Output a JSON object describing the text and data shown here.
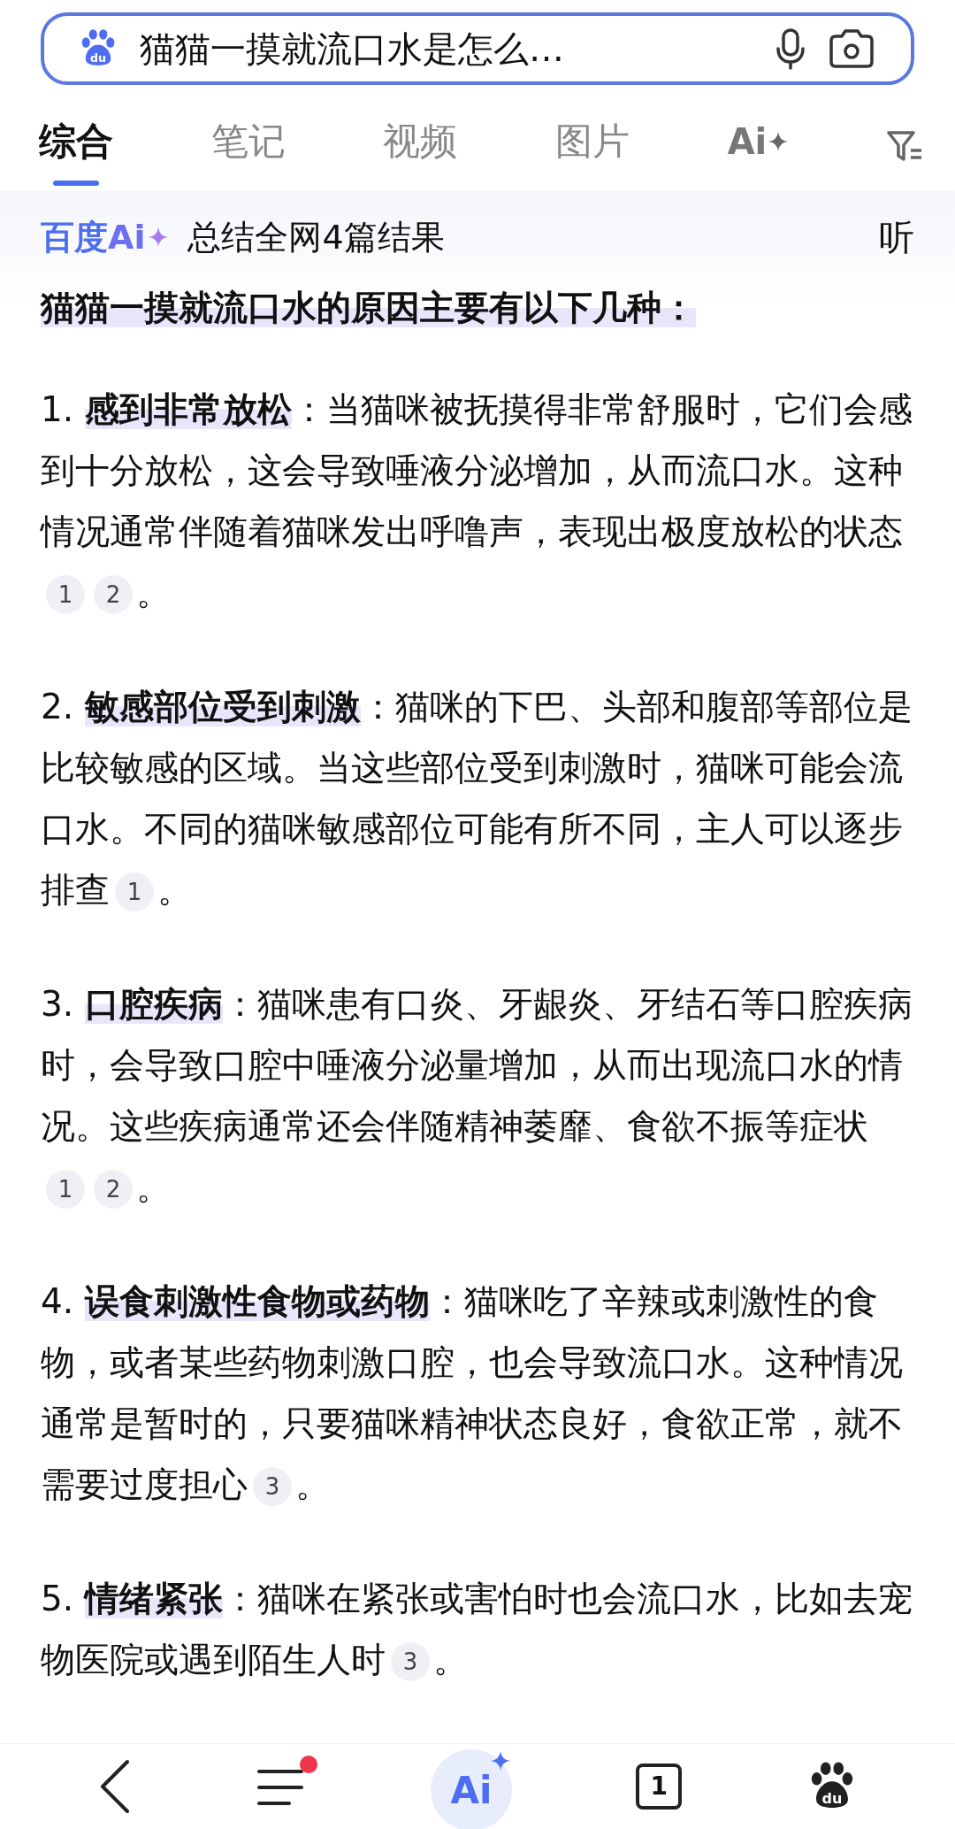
{
  "search": {
    "logo_text": "du",
    "query": "猫猫一摸就流口水是怎么…"
  },
  "tabs": [
    {
      "label": "综合",
      "kind": "text",
      "selected": true
    },
    {
      "label": "笔记",
      "kind": "text",
      "selected": false
    },
    {
      "label": "视频",
      "kind": "text",
      "selected": false
    },
    {
      "label": "图片",
      "kind": "text",
      "selected": false
    },
    {
      "label": "Ai",
      "kind": "ai",
      "selected": false
    }
  ],
  "ai_header": {
    "brand": "百度",
    "brand_ai": "Ai",
    "summary": "总结全网4篇结果",
    "listen": "听"
  },
  "intro": "猫猫一摸就流口水的原因主要有以下几种：",
  "items": [
    {
      "number": "1.",
      "title": "感到非常放松",
      "text": "：当猫咪被抚摸得非常舒服时，它们会感到十分放松，这会导致唾液分泌增加，从而流口水。这种情况通常伴随着猫咪发出呼噜声，表现出极度放松的状态",
      "citations": [
        "1",
        "2"
      ],
      "end": "。"
    },
    {
      "number": "2.",
      "title": "敏感部位受到刺激",
      "text": "：猫咪的下巴、头部和腹部等部位是比较敏感的区域。当这些部位受到刺激时，猫咪可能会流口水。不同的猫咪敏感部位可能有所不同，主人可以逐步排查",
      "citations": [
        "1"
      ],
      "end": "。"
    },
    {
      "number": "3.",
      "title": "口腔疾病",
      "text": "：猫咪患有口炎、牙龈炎、牙结石等口腔疾病时，会导致口腔中唾液分泌量增加，从而出现流口水的情况。这些疾病通常还会伴随精神萎靡、食欲不振等症状",
      "citations": [
        "1",
        "2"
      ],
      "end": "。"
    },
    {
      "number": "4.",
      "title": "误食刺激性食物或药物",
      "text": "：猫咪吃了辛辣或刺激性的食物，或者某些药物刺激口腔，也会导致流口水。这种情况通常是暂时的，只要猫咪精神状态良好，食欲正常，就不需要过度担心",
      "citations": [
        "3"
      ],
      "end": "。"
    },
    {
      "number": "5.",
      "title": "情绪紧张",
      "text": "：猫咪在紧张或害怕时也会流口水，比如去宠物医院或遇到陌生人时",
      "citations": [
        "3"
      ],
      "end": "。"
    }
  ],
  "bottom_nav": {
    "menu_notification": true,
    "ai_label": "Ai",
    "tab_count": "1",
    "logo_text": "du"
  }
}
